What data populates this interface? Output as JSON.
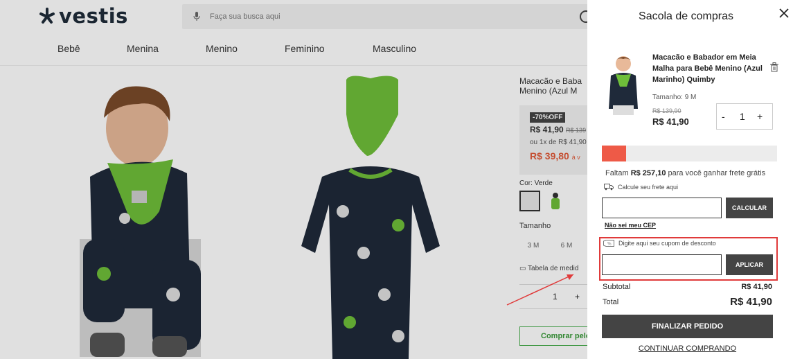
{
  "header": {
    "logo_text": "vestis",
    "search_placeholder": "Faça sua busca aqui",
    "nav": [
      "Bebê",
      "Menina",
      "Menino",
      "Feminino",
      "Masculino"
    ]
  },
  "product": {
    "title": "Macacão e Baba... Menino (Azul M...",
    "title_line1": "Macacão e Baba",
    "title_line2": "Menino (Azul M",
    "discount_badge": "-70%OFF",
    "price": "R$ 41,90",
    "old_price": "R$ 139",
    "installments": "ou 1x de R$ 41,90",
    "pix_price": "R$ 39,80",
    "pix_suffix": "à v",
    "color_label": "Cor: Verde",
    "size_label": "Tamanho",
    "sizes": [
      "3 M",
      "6 M"
    ],
    "size_table": "Tabela de medid",
    "qty": "1",
    "qty_plus": "+",
    "whatsapp": "Comprar pelo"
  },
  "cart": {
    "title": "Sacola de compras",
    "item": {
      "name": "Macacão e Babador em Meia Malha para Bebê Menino (Azul Marinho) Quimby",
      "size": "Tamanho: 9 M",
      "old_price": "R$ 139,90",
      "price": "R$ 41,90",
      "qty": "1",
      "minus": "-",
      "plus": "+"
    },
    "free_shipping_progress": 0.14,
    "free_shipping_prefix": "Faltam",
    "free_shipping_amount": "R$ 257,10",
    "free_shipping_suffix": "para você ganhar frete grátis",
    "calc_shipping_label": "Calcule seu frete aqui",
    "calc_button": "CALCULAR",
    "cep_link": "Não sei meu CEP",
    "coupon_label": "Digite aqui seu cupom de desconto",
    "coupon_button": "APLICAR",
    "subtotal_label": "Subtotal",
    "subtotal_value": "R$ 41,90",
    "total_label": "Total",
    "total_value": "R$ 41,90",
    "finish_button": "FINALIZAR PEDIDO",
    "continue_link": "CONTINUAR COMPRANDO"
  },
  "colors": {
    "accent_red": "#ee5a47",
    "highlight_red": "#e03a3a",
    "button_dark": "#444444",
    "whatsapp_green": "#4caf50"
  }
}
